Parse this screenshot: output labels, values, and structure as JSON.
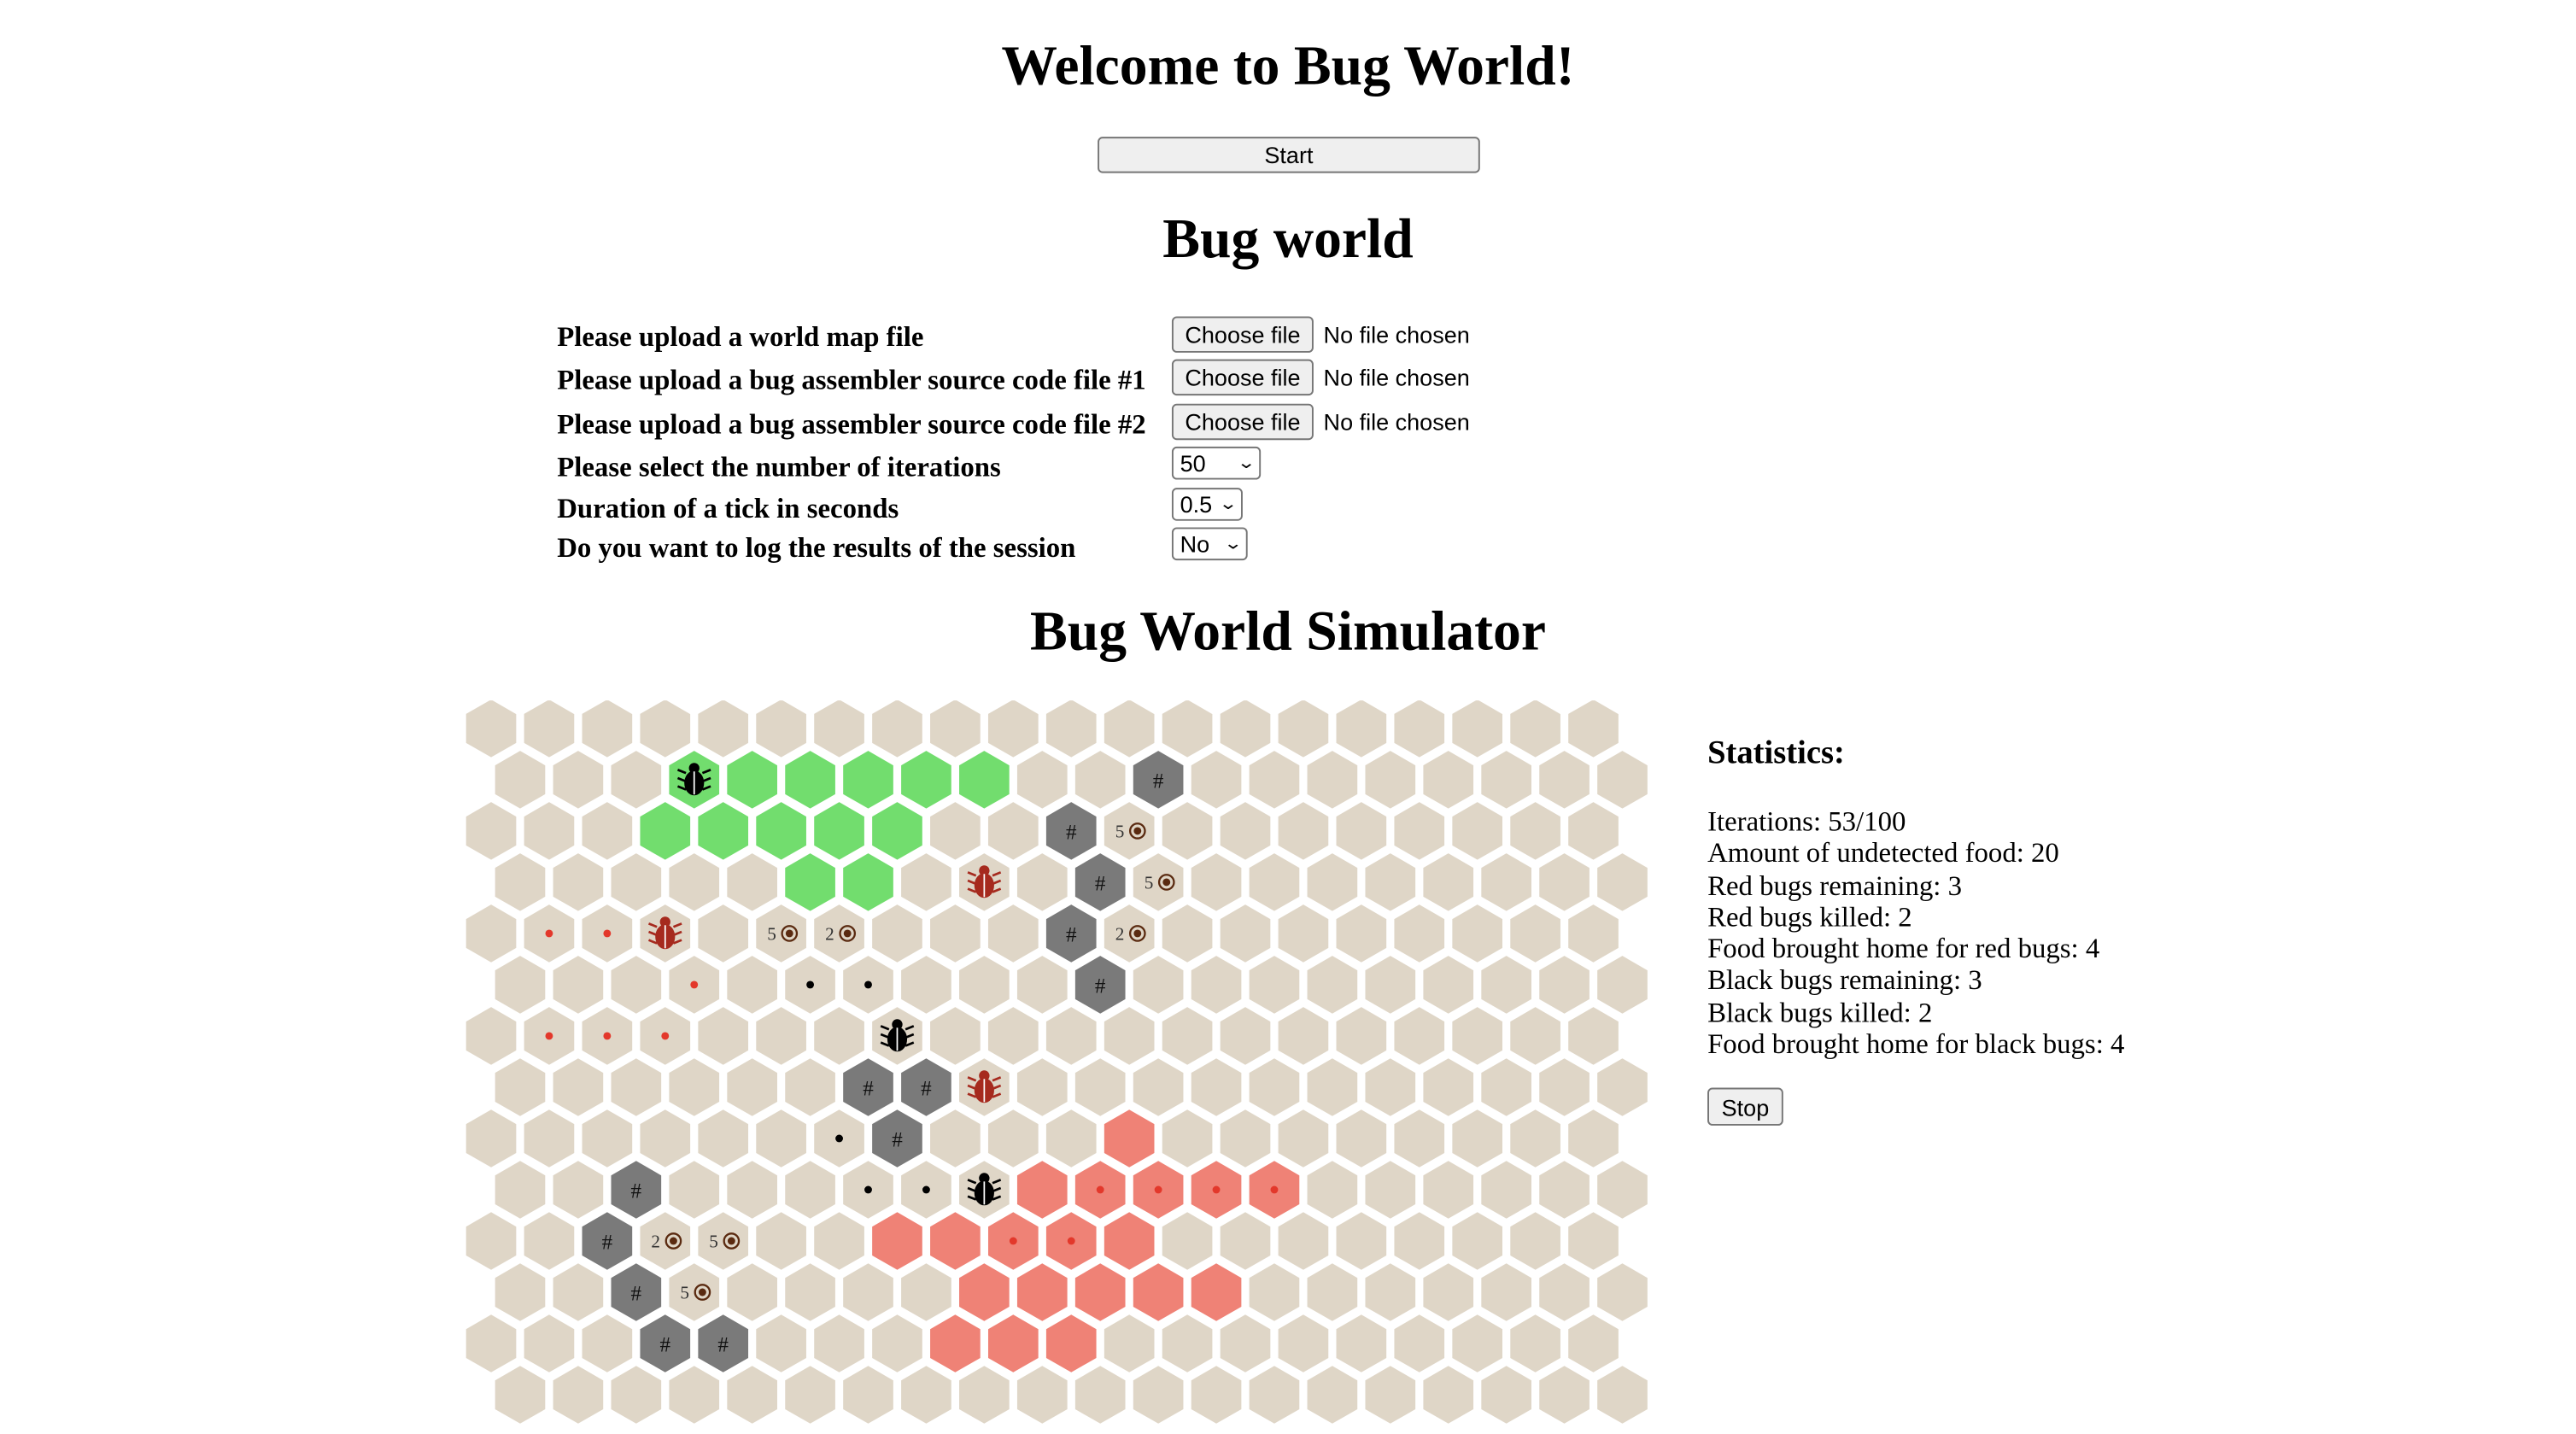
{
  "header": {
    "welcome_title": "Welcome to Bug World!",
    "start_label": "Start"
  },
  "setup": {
    "title": "Bug world",
    "rows": [
      {
        "label": "Please upload a world map file",
        "button": "Choose file",
        "status": "No file chosen"
      },
      {
        "label": "Please upload a bug assembler source code file #1",
        "button": "Choose file",
        "status": "No file chosen"
      },
      {
        "label": "Please upload a bug assembler source code file #2",
        "button": "Choose file",
        "status": "No file chosen"
      }
    ],
    "iterations": {
      "label": "Please select the number of iterations",
      "value": "50"
    },
    "tick": {
      "label": "Duration of a tick in seconds",
      "value": "0.5"
    },
    "log": {
      "label": "Do you want to log the results of the session",
      "value": "No"
    }
  },
  "simulator": {
    "title": "Bug World Simulator",
    "colors": {
      "empty": "#dfd6c7",
      "rock": "#7a7a7a",
      "green_nest": "#72dd6e",
      "red_nest": "#ef8276",
      "red_marker": "#e3382b",
      "black_marker": "#000000",
      "red_bug": "#a62a1e",
      "black_bug": "#000000"
    },
    "legend_icons": {
      "rock": "#",
      "food": "food-icon",
      "bug": "bug-icon"
    },
    "grid": {
      "rows": 14,
      "cols": 20,
      "cells": [
        {
          "r": 1,
          "c": 3,
          "t": "green",
          "bug": "black"
        },
        {
          "r": 1,
          "c": 4,
          "t": "green"
        },
        {
          "r": 1,
          "c": 5,
          "t": "green"
        },
        {
          "r": 1,
          "c": 6,
          "t": "green"
        },
        {
          "r": 1,
          "c": 7,
          "t": "green"
        },
        {
          "r": 1,
          "c": 8,
          "t": "green"
        },
        {
          "r": 2,
          "c": 3,
          "t": "green"
        },
        {
          "r": 2,
          "c": 4,
          "t": "green"
        },
        {
          "r": 2,
          "c": 5,
          "t": "green"
        },
        {
          "r": 2,
          "c": 6,
          "t": "green"
        },
        {
          "r": 2,
          "c": 7,
          "t": "green"
        },
        {
          "r": 3,
          "c": 5,
          "t": "green"
        },
        {
          "r": 3,
          "c": 6,
          "t": "green"
        },
        {
          "r": 1,
          "c": 11,
          "t": "rock",
          "label": "#"
        },
        {
          "r": 2,
          "c": 10,
          "t": "rock",
          "label": "#"
        },
        {
          "r": 2,
          "c": 11,
          "food": "5"
        },
        {
          "r": 3,
          "c": 8,
          "bug": "red"
        },
        {
          "r": 3,
          "c": 10,
          "t": "rock",
          "label": "#"
        },
        {
          "r": 3,
          "c": 11,
          "food": "5"
        },
        {
          "r": 4,
          "c": 1,
          "mark": "red"
        },
        {
          "r": 4,
          "c": 2,
          "mark": "red"
        },
        {
          "r": 4,
          "c": 3,
          "bug": "red"
        },
        {
          "r": 4,
          "c": 5,
          "food": "5"
        },
        {
          "r": 4,
          "c": 6,
          "food": "2"
        },
        {
          "r": 4,
          "c": 10,
          "t": "rock",
          "label": "#"
        },
        {
          "r": 4,
          "c": 11,
          "food": "2"
        },
        {
          "r": 5,
          "c": 3,
          "mark": "red"
        },
        {
          "r": 5,
          "c": 5,
          "mark": "black"
        },
        {
          "r": 5,
          "c": 6,
          "mark": "black"
        },
        {
          "r": 5,
          "c": 10,
          "t": "rock",
          "label": "#"
        },
        {
          "r": 6,
          "c": 1,
          "mark": "red"
        },
        {
          "r": 6,
          "c": 2,
          "mark": "red"
        },
        {
          "r": 6,
          "c": 3,
          "mark": "red"
        },
        {
          "r": 6,
          "c": 7,
          "bug": "black"
        },
        {
          "r": 7,
          "c": 6,
          "t": "rock",
          "label": "#"
        },
        {
          "r": 7,
          "c": 7,
          "t": "rock",
          "label": "#"
        },
        {
          "r": 7,
          "c": 8,
          "bug": "red"
        },
        {
          "r": 8,
          "c": 6,
          "mark": "black"
        },
        {
          "r": 8,
          "c": 7,
          "t": "rock",
          "label": "#"
        },
        {
          "r": 8,
          "c": 11,
          "t": "red"
        },
        {
          "r": 9,
          "c": 2,
          "t": "rock",
          "label": "#"
        },
        {
          "r": 9,
          "c": 6,
          "mark": "black"
        },
        {
          "r": 9,
          "c": 7,
          "mark": "black"
        },
        {
          "r": 9,
          "c": 8,
          "bug": "black"
        },
        {
          "r": 9,
          "c": 9,
          "t": "red"
        },
        {
          "r": 9,
          "c": 10,
          "t": "red",
          "mark": "red"
        },
        {
          "r": 9,
          "c": 11,
          "t": "red",
          "mark": "red"
        },
        {
          "r": 9,
          "c": 12,
          "t": "red",
          "mark": "red"
        },
        {
          "r": 9,
          "c": 13,
          "t": "red",
          "mark": "red"
        },
        {
          "r": 10,
          "c": 2,
          "t": "rock",
          "label": "#"
        },
        {
          "r": 10,
          "c": 3,
          "food": "2"
        },
        {
          "r": 10,
          "c": 4,
          "food": "5"
        },
        {
          "r": 10,
          "c": 7,
          "t": "red"
        },
        {
          "r": 10,
          "c": 8,
          "t": "red"
        },
        {
          "r": 10,
          "c": 9,
          "t": "red",
          "mark": "red"
        },
        {
          "r": 10,
          "c": 10,
          "t": "red",
          "mark": "red"
        },
        {
          "r": 10,
          "c": 11,
          "t": "red"
        },
        {
          "r": 11,
          "c": 2,
          "t": "rock",
          "label": "#"
        },
        {
          "r": 11,
          "c": 3,
          "food": "5"
        },
        {
          "r": 11,
          "c": 8,
          "t": "red"
        },
        {
          "r": 11,
          "c": 9,
          "t": "red"
        },
        {
          "r": 11,
          "c": 10,
          "t": "red"
        },
        {
          "r": 11,
          "c": 11,
          "t": "red"
        },
        {
          "r": 11,
          "c": 12,
          "t": "red"
        },
        {
          "r": 12,
          "c": 3,
          "t": "rock",
          "label": "#"
        },
        {
          "r": 12,
          "c": 4,
          "t": "rock",
          "label": "#"
        },
        {
          "r": 12,
          "c": 8,
          "t": "red"
        },
        {
          "r": 12,
          "c": 9,
          "t": "red"
        },
        {
          "r": 12,
          "c": 10,
          "t": "red"
        }
      ]
    },
    "statistics": {
      "title": "Statistics:",
      "lines": [
        "Iterations: 53/100",
        "Amount of undetected food: 20",
        "Red bugs remaining: 3",
        "Red bugs killed: 2",
        "Food brought home for red bugs: 4",
        "Black bugs remaining: 3",
        "Black bugs killed: 2",
        "Food brought home for black bugs: 4"
      ],
      "stop_label": "Stop"
    }
  }
}
